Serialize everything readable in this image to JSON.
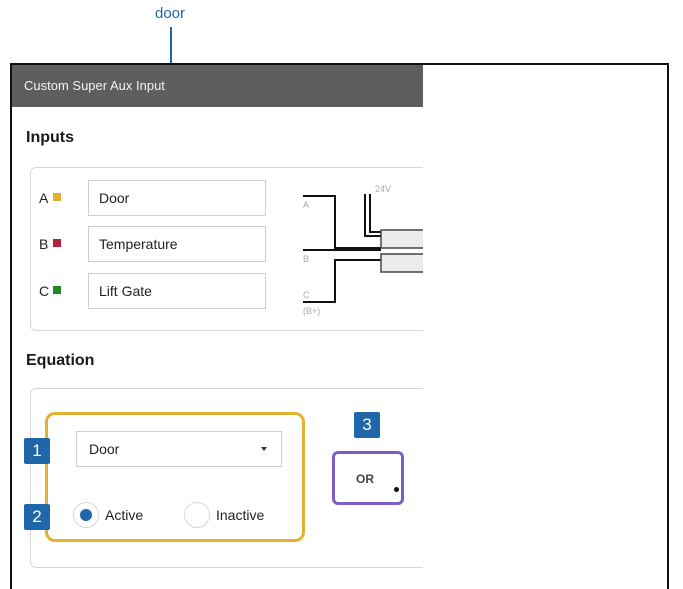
{
  "callout": {
    "label": "door"
  },
  "window": {
    "title": "Custom Super Aux Input"
  },
  "inputs": {
    "heading": "Inputs",
    "rows": [
      {
        "letter": "A",
        "name": "Door",
        "color": "#e5b030"
      },
      {
        "letter": "B",
        "name": "Temperature",
        "color": "#b0243f"
      },
      {
        "letter": "C",
        "name": "Lift Gate",
        "color": "#1f8a1f"
      }
    ],
    "diagram": {
      "label_24v": "24V",
      "label_a": "A",
      "label_b": "B",
      "label_c": "C",
      "label_bplus": "(B+)"
    }
  },
  "equation": {
    "heading": "Equation",
    "selected_input": "Door",
    "radio_active": "Active",
    "radio_inactive": "Inactive",
    "operator": "OR"
  },
  "badges": {
    "one": "1",
    "two": "2",
    "three": "3"
  },
  "colors": {
    "accent_blue": "#1f67a8",
    "highlight_yellow": "#e5b030",
    "highlight_purple": "#7b5fc7",
    "titlebar": "#5e5e5e"
  }
}
